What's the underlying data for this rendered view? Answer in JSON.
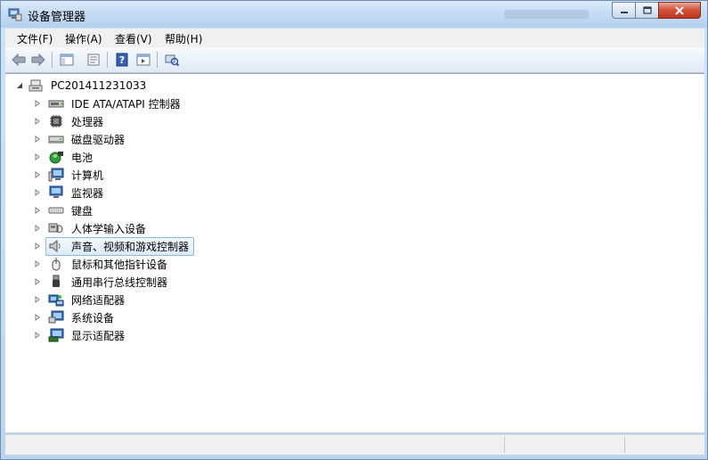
{
  "window": {
    "title": "设备管理器"
  },
  "menu": [
    {
      "label": "文件(F)"
    },
    {
      "label": "操作(A)"
    },
    {
      "label": "查看(V)"
    },
    {
      "label": "帮助(H)"
    }
  ],
  "toolbar": {
    "icons": [
      "back-arrow-icon",
      "forward-arrow-icon",
      "show-hide-tree-icon",
      "properties-icon",
      "help-icon",
      "action-pane-icon",
      "scan-hardware-icon"
    ]
  },
  "tree": {
    "root": "PC201411231033",
    "items": [
      {
        "label": "IDE ATA/ATAPI 控制器",
        "icon": "ide-controller-icon"
      },
      {
        "label": "处理器",
        "icon": "processor-icon"
      },
      {
        "label": "磁盘驱动器",
        "icon": "disk-drive-icon"
      },
      {
        "label": "电池",
        "icon": "battery-icon"
      },
      {
        "label": "计算机",
        "icon": "computer-icon"
      },
      {
        "label": "监视器",
        "icon": "monitor-icon"
      },
      {
        "label": "键盘",
        "icon": "keyboard-icon"
      },
      {
        "label": "人体学输入设备",
        "icon": "hid-icon"
      },
      {
        "label": "声音、视频和游戏控制器",
        "icon": "speaker-icon",
        "selected": true
      },
      {
        "label": "鼠标和其他指针设备",
        "icon": "mouse-icon"
      },
      {
        "label": "通用串行总线控制器",
        "icon": "usb-icon"
      },
      {
        "label": "网络适配器",
        "icon": "network-adapter-icon"
      },
      {
        "label": "系统设备",
        "icon": "system-device-icon"
      },
      {
        "label": "显示适配器",
        "icon": "display-adapter-icon"
      }
    ]
  },
  "colors": {
    "selection_border": "#8ab8e8",
    "title_gradient": "#c4dbf3",
    "close_button": "#c2341c"
  }
}
